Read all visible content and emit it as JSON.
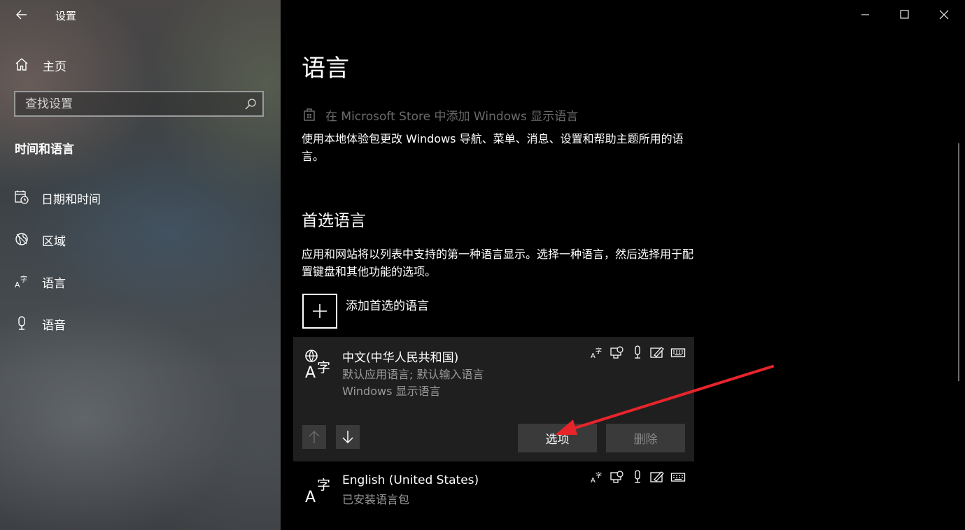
{
  "window": {
    "title": "设置",
    "controls": [
      "minimize-icon",
      "maximize-icon",
      "close-icon"
    ]
  },
  "sidebar": {
    "home_label": "主页",
    "search": {
      "placeholder": "查找设置",
      "value": ""
    },
    "section_title": "时间和语言",
    "items": [
      {
        "label": "日期和时间",
        "icon": "calendar-clock-icon"
      },
      {
        "label": "区域",
        "icon": "globe-region-icon"
      },
      {
        "label": "语言",
        "icon": "language-icon"
      },
      {
        "label": "语音",
        "icon": "microphone-icon"
      }
    ]
  },
  "main": {
    "title": "语言",
    "store_link": "在 Microsoft Store 中添加 Windows 显示语言",
    "store_desc": "使用本地体验包更改 Windows 导航、菜单、消息、设置和帮助主题所用的语言。",
    "preferred_title": "首选语言",
    "preferred_desc": "应用和网站将以列表中支持的第一种语言显示。选择一种语言，然后选择用于配置键盘和其他功能的选项。",
    "add_label": "添加首选的语言",
    "languages": [
      {
        "name": "中文(中华人民共和国)",
        "line1": "默认应用语言; 默认输入语言",
        "line2": "Windows 显示语言",
        "features": [
          "display-language-icon",
          "text-to-speech-icon",
          "speech-recognition-icon",
          "handwriting-icon",
          "keyboard-icon"
        ],
        "selected": true,
        "options_label": "选项",
        "remove_label": "删除",
        "move_up_enabled": false,
        "move_down_enabled": true
      },
      {
        "name": "English (United States)",
        "line1": "已安装语言包",
        "features": [
          "display-language-icon",
          "text-to-speech-icon",
          "speech-recognition-icon",
          "handwriting-icon",
          "keyboard-icon"
        ]
      }
    ]
  },
  "annotation": {
    "type": "red-arrow",
    "target": "options-button",
    "color": "#e8242b"
  },
  "colors": {
    "sidebar_tint": "#3f4346",
    "card_bg": "#1f1f1f",
    "button_bg": "#3a3a3a",
    "muted_text": "#9a9a9a",
    "disabled_text": "#6a6a6a"
  }
}
